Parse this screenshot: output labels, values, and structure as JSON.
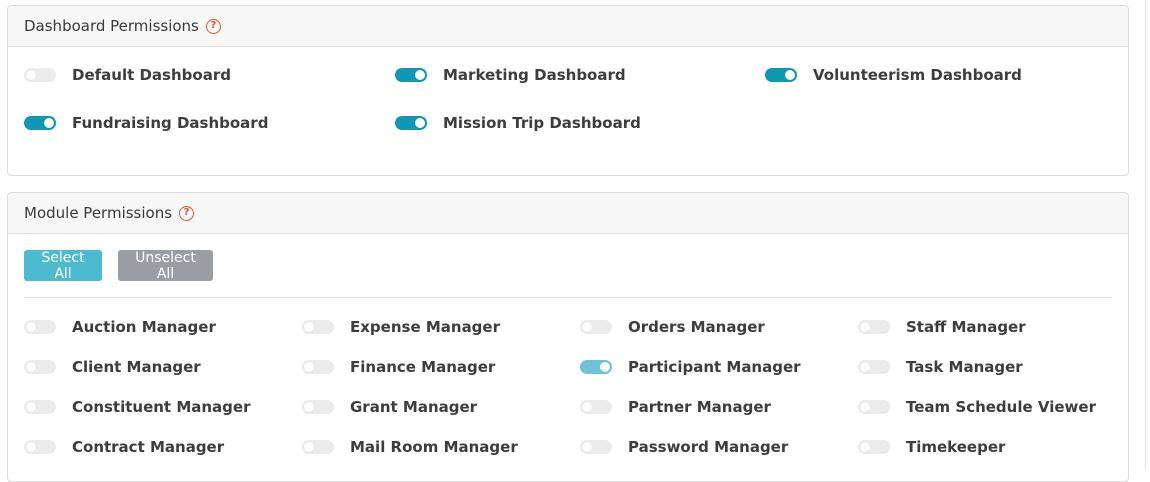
{
  "dashboard_permissions": {
    "title": "Dashboard Permissions",
    "help_icon": "question-circle-icon",
    "items": [
      {
        "label": "Default Dashboard",
        "enabled": false
      },
      {
        "label": "Marketing Dashboard",
        "enabled": true
      },
      {
        "label": "Volunteerism Dashboard",
        "enabled": true
      },
      {
        "label": "Fundraising Dashboard",
        "enabled": true
      },
      {
        "label": "Mission Trip Dashboard",
        "enabled": true
      }
    ]
  },
  "module_permissions": {
    "title": "Module Permissions",
    "help_icon": "question-circle-icon",
    "select_all_label": "Select All",
    "unselect_all_label": "Unselect All",
    "items": [
      {
        "label": "Auction Manager",
        "enabled": false
      },
      {
        "label": "Expense Manager",
        "enabled": false
      },
      {
        "label": "Orders Manager",
        "enabled": false
      },
      {
        "label": "Staff Manager",
        "enabled": false
      },
      {
        "label": "Client Manager",
        "enabled": false
      },
      {
        "label": "Finance Manager",
        "enabled": false
      },
      {
        "label": "Participant Manager",
        "enabled": true
      },
      {
        "label": "Task Manager",
        "enabled": false
      },
      {
        "label": "Constituent Manager",
        "enabled": false
      },
      {
        "label": "Grant Manager",
        "enabled": false
      },
      {
        "label": "Partner Manager",
        "enabled": false
      },
      {
        "label": "Team Schedule Viewer",
        "enabled": false
      },
      {
        "label": "Contract Manager",
        "enabled": false
      },
      {
        "label": "Mail Room Manager",
        "enabled": false
      },
      {
        "label": "Password Manager",
        "enabled": false
      },
      {
        "label": "Timekeeper",
        "enabled": false
      }
    ]
  },
  "colors": {
    "toggle_on": "#0f97b4",
    "toggle_off": "#ebebeb",
    "help_icon": "#e2542f",
    "select_all_button": "#4cbbd0",
    "unselect_all_button": "#9a9ea2"
  }
}
